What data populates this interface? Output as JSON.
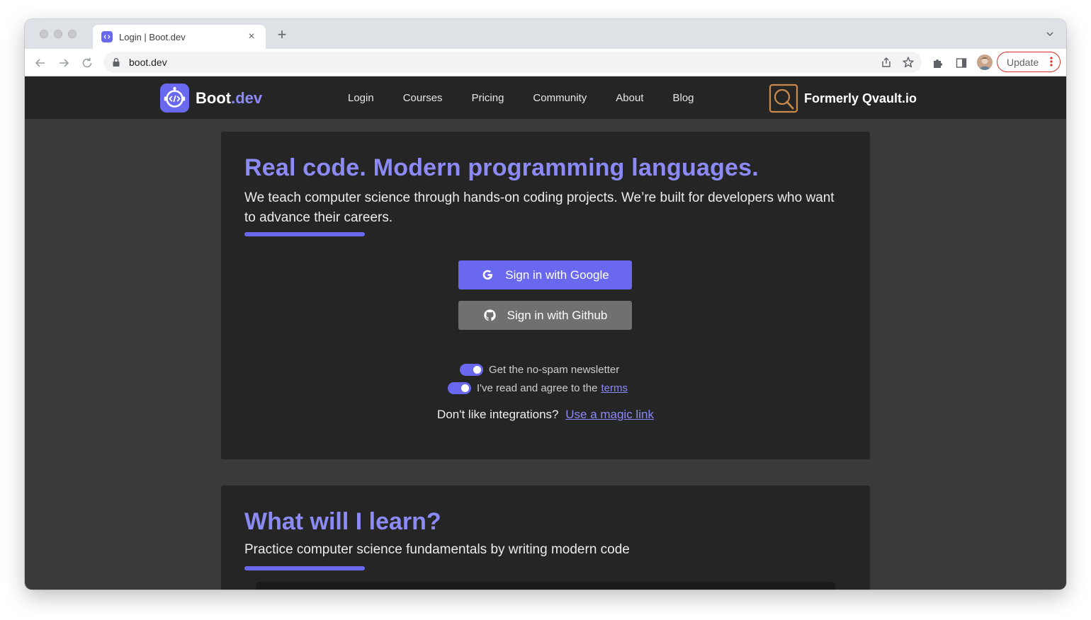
{
  "browser": {
    "tab_title": "Login | Boot.dev",
    "tab_close": "×",
    "new_tab": "+",
    "url": "boot.dev",
    "update_label": "Update",
    "update_menu": "⋮"
  },
  "site": {
    "brand_name": "Boot",
    "brand_suffix": ".dev",
    "nav_links": [
      "Login",
      "Courses",
      "Pricing",
      "Community",
      "About",
      "Blog"
    ],
    "partner_text": "Formerly Qvault.io"
  },
  "hero": {
    "title": "Real code. Modern programming languages.",
    "subtitle": "We teach computer science through hands-on coding projects. We’re built for developers who want to advance their careers."
  },
  "auth": {
    "google_label": "Sign in with Google",
    "github_label": "Sign in with Github",
    "newsletter_label": "Get the no-spam newsletter",
    "newsletter_on": true,
    "terms_prefix": "I've read and agree to the",
    "terms_link": "terms",
    "terms_on": true,
    "magic_prefix": "Don't like integrations?",
    "magic_link": "Use a magic link"
  },
  "learn": {
    "title": "What will I learn?",
    "subtitle": "Practice computer science fundamentals by writing modern code"
  },
  "colors": {
    "accent": "#6a68ee",
    "accent_text": "#8c8af4",
    "page_bg": "#3a3a3b",
    "card_bg": "#252526",
    "github_btn": "#707070"
  },
  "icons": [
    "lock-icon",
    "google-icon",
    "github-icon",
    "share-icon",
    "star-icon",
    "extensions-icon",
    "sidepanel-icon",
    "back-icon",
    "forward-icon",
    "reload-icon"
  ]
}
